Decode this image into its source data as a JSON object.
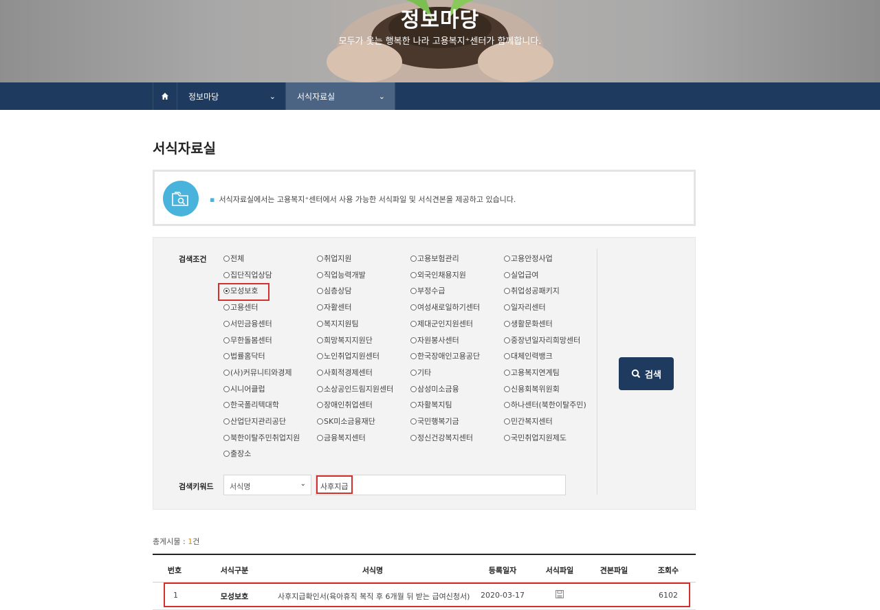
{
  "hero": {
    "title": "정보마당",
    "subtitle": "모두가 웃는 행복한 나라 고용복지⁺센터가 함께합니다."
  },
  "nav": {
    "home_icon": "home-icon",
    "menu1": "정보마당",
    "menu2": "서식자료실"
  },
  "page_title": "서식자료실",
  "info_text": "서식자료실에서는 고용복지⁺센터에서 사용 가능한 서식파일 및 서식견본을 제공하고 있습니다.",
  "search": {
    "condition_label": "검색조건",
    "keyword_label": "검색키워드",
    "options": [
      "전체",
      "취업지원",
      "고용보험관리",
      "고용안정사업",
      "집단직업상담",
      "직업능력개발",
      "외국인채용지원",
      "실업급여",
      "모성보호",
      "심층상담",
      "부정수급",
      "취업성공패키지",
      "고용센터",
      "자활센터",
      "여성새로일하기센터",
      "일자리센터",
      "서민금융센터",
      "복지지원팀",
      "제대군인지원센터",
      "생활문화센터",
      "무한돌봄센터",
      "희망복지지원단",
      "자원봉사센터",
      "중장년일자리희망센터",
      "법률홈닥터",
      "노인취업지원센터",
      "한국장애인고용공단",
      "대체인력뱅크",
      "(사)커뮤니티와경제",
      "사회적경제센터",
      "기타",
      "고용복지연계팀",
      "시니어클럽",
      "소상공인드림지원센터",
      "삼성미소금융",
      "신용회복위원회",
      "한국폴리텍대학",
      "장애인취업센터",
      "자활복지팀",
      "하나센터(북한이탈주민)",
      "산업단지관리공단",
      "SK미소금융재단",
      "국민행복기금",
      "민간복지센터",
      "북한이탈주민취업지원",
      "금융복지센터",
      "정신건강복지센터",
      "국민취업지원제도",
      "출장소"
    ],
    "selected": "모성보호",
    "select_value": "서식명",
    "keyword_value": "사후지급",
    "button_label": "검색"
  },
  "result": {
    "total_prefix": "총게시물 : ",
    "total_count": "1",
    "total_suffix": "건",
    "headers": [
      "번호",
      "서식구분",
      "서식명",
      "등록일자",
      "서식파일",
      "견본파일",
      "조회수"
    ],
    "rows": [
      {
        "no": "1",
        "category": "모성보호",
        "name": "사후지급확인서(육아휴직 복직 후 6개월 뒤 받는 급여신청서)",
        "date": "2020-03-17",
        "file_icon": "save-icon",
        "views": "6102"
      }
    ]
  },
  "colors": {
    "navy": "#1f3a5f",
    "accent": "#4ab3dc",
    "highlight": "#d32f2f"
  }
}
